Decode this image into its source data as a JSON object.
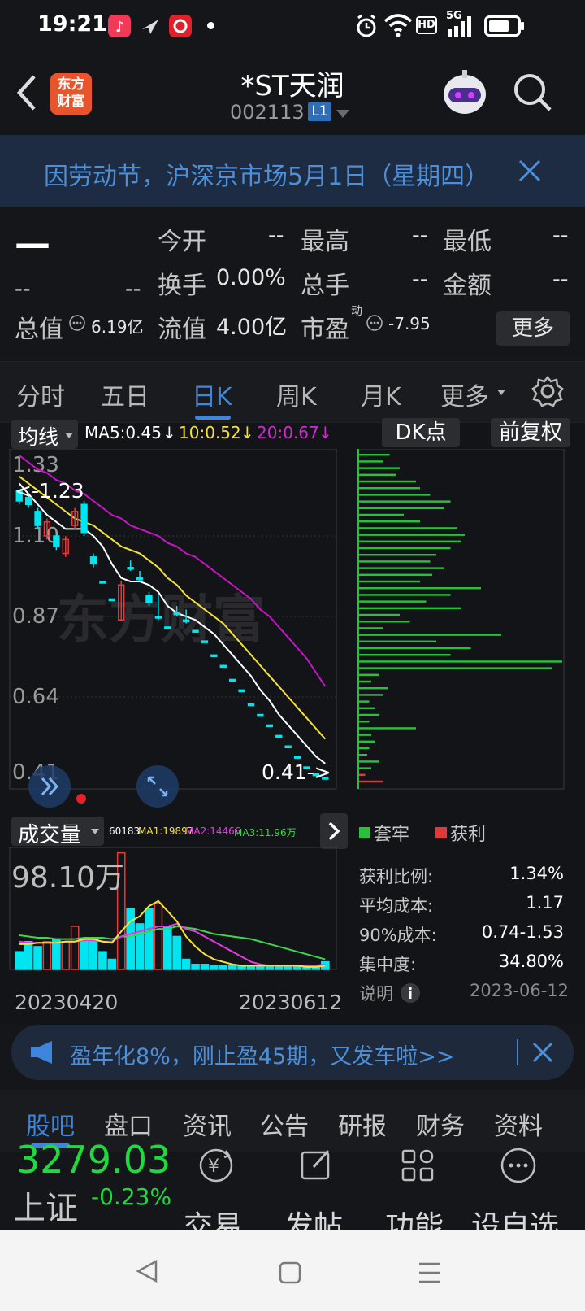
{
  "status_bar": {
    "time": "19:21",
    "battery": "battery-icon",
    "network": "5G",
    "hd": "HD"
  },
  "header": {
    "logo_line1": "东方",
    "logo_line2": "财富",
    "stock_name": "*ST天润",
    "stock_code": "002113",
    "level_badge": "L1"
  },
  "notice": {
    "text": "因劳动节，沪深京市场5月1日（星期四）"
  },
  "quote": {
    "price": "—",
    "change": "--",
    "change_pct": "--",
    "open_label": "今开",
    "open_val": "--",
    "high_label": "最高",
    "high_val": "--",
    "low_label": "最低",
    "low_val": "--",
    "turnover_label": "换手",
    "turnover_val": "0.00%",
    "volume_label": "总手",
    "volume_val": "--",
    "amount_label": "金额",
    "amount_val": "--",
    "mcap_label": "总值",
    "mcap_val": "6.19亿",
    "float_label": "流值",
    "float_val": "4.00亿",
    "pe_label": "市盈",
    "pe_super": "动",
    "pe_val": "-7.95",
    "more_button": "更多"
  },
  "k_tabs": [
    "分时",
    "五日",
    "日K",
    "周K",
    "月K",
    "更多"
  ],
  "k_tab_active": 2,
  "chart_toolbar": {
    "ma_select": "均线",
    "ma5": "MA5:0.45",
    "ma10": "10:0.52",
    "ma20": "20:0.67",
    "dk_button": "DK点",
    "adjust_button": "前复权"
  },
  "kline": {
    "y_labels": [
      "1.33",
      "1.10",
      "0.87",
      "0.64",
      "0.41"
    ],
    "high_marker": "<-1.23",
    "low_marker": "0.41->",
    "watermark": "东方财富",
    "colors": {
      "up": "#e83a3a",
      "down": "#00e5ef",
      "ma5": "#ffffff",
      "ma10": "#f5e13a",
      "ma20": "#c814c8"
    }
  },
  "chart_data": {
    "type": "candlestick",
    "x_start": "20230420",
    "x_end": "20230612",
    "ylim": [
      0.41,
      1.33
    ],
    "candles": [
      {
        "o": 1.23,
        "c": 1.2,
        "h": 1.23,
        "l": 1.19
      },
      {
        "o": 1.21,
        "c": 1.19,
        "h": 1.22,
        "l": 1.18
      },
      {
        "o": 1.17,
        "c": 1.13,
        "h": 1.18,
        "l": 1.12
      },
      {
        "o": 1.1,
        "c": 1.14,
        "h": 1.15,
        "l": 1.09
      },
      {
        "o": 1.1,
        "c": 1.07,
        "h": 1.11,
        "l": 1.06
      },
      {
        "o": 1.05,
        "c": 1.09,
        "h": 1.1,
        "l": 1.04
      },
      {
        "o": 1.13,
        "c": 1.17,
        "h": 1.18,
        "l": 1.12
      },
      {
        "o": 1.19,
        "c": 1.11,
        "h": 1.2,
        "l": 1.1
      },
      {
        "o": 1.04,
        "c": 1.02,
        "h": 1.05,
        "l": 1.01
      },
      {
        "o": 0.97,
        "c": 0.97,
        "h": 0.97,
        "l": 0.97
      },
      {
        "o": 0.92,
        "c": 0.92,
        "h": 0.92,
        "l": 0.92
      },
      {
        "o": 0.86,
        "c": 0.96,
        "h": 0.97,
        "l": 0.86
      },
      {
        "o": 1.01,
        "c": 1.01,
        "h": 1.03,
        "l": 1.0
      },
      {
        "o": 0.98,
        "c": 0.98,
        "h": 1.0,
        "l": 0.97
      },
      {
        "o": 0.93,
        "c": 0.91,
        "h": 0.94,
        "l": 0.9
      },
      {
        "o": 0.87,
        "c": 0.87,
        "h": 0.93,
        "l": 0.86
      },
      {
        "o": 0.84,
        "c": 0.84,
        "h": 0.84,
        "l": 0.84
      },
      {
        "o": 0.88,
        "c": 0.88,
        "h": 0.9,
        "l": 0.87
      },
      {
        "o": 0.86,
        "c": 0.86,
        "h": 0.89,
        "l": 0.85
      },
      {
        "o": 0.83,
        "c": 0.83,
        "h": 0.83,
        "l": 0.83
      },
      {
        "o": 0.8,
        "c": 0.8,
        "h": 0.8,
        "l": 0.8
      },
      {
        "o": 0.76,
        "c": 0.76,
        "h": 0.76,
        "l": 0.76
      },
      {
        "o": 0.73,
        "c": 0.73,
        "h": 0.73,
        "l": 0.73
      },
      {
        "o": 0.69,
        "c": 0.69,
        "h": 0.69,
        "l": 0.69
      },
      {
        "o": 0.66,
        "c": 0.66,
        "h": 0.66,
        "l": 0.66
      },
      {
        "o": 0.62,
        "c": 0.62,
        "h": 0.62,
        "l": 0.62
      },
      {
        "o": 0.59,
        "c": 0.59,
        "h": 0.59,
        "l": 0.59
      },
      {
        "o": 0.56,
        "c": 0.56,
        "h": 0.56,
        "l": 0.56
      },
      {
        "o": 0.53,
        "c": 0.53,
        "h": 0.53,
        "l": 0.53
      },
      {
        "o": 0.5,
        "c": 0.5,
        "h": 0.5,
        "l": 0.5
      },
      {
        "o": 0.47,
        "c": 0.47,
        "h": 0.47,
        "l": 0.47
      },
      {
        "o": 0.44,
        "c": 0.44,
        "h": 0.44,
        "l": 0.44
      },
      {
        "o": 0.42,
        "c": 0.42,
        "h": 0.42,
        "l": 0.42
      },
      {
        "o": 0.41,
        "c": 0.41,
        "h": 0.41,
        "l": 0.41
      }
    ],
    "ma5": [
      1.25,
      1.22,
      1.19,
      1.16,
      1.14,
      1.12,
      1.12,
      1.12,
      1.1,
      1.07,
      1.02,
      0.98,
      0.97,
      0.97,
      0.96,
      0.94,
      0.9,
      0.88,
      0.87,
      0.86,
      0.84,
      0.82,
      0.79,
      0.76,
      0.73,
      0.7,
      0.66,
      0.63,
      0.59,
      0.56,
      0.53,
      0.5,
      0.47,
      0.45
    ],
    "ma10": [
      1.27,
      1.25,
      1.23,
      1.21,
      1.19,
      1.17,
      1.15,
      1.14,
      1.13,
      1.11,
      1.09,
      1.07,
      1.06,
      1.05,
      1.03,
      1.01,
      0.98,
      0.96,
      0.93,
      0.91,
      0.89,
      0.87,
      0.85,
      0.82,
      0.79,
      0.76,
      0.73,
      0.7,
      0.67,
      0.64,
      0.61,
      0.58,
      0.55,
      0.52
    ],
    "ma20": [
      1.33,
      1.31,
      1.29,
      1.28,
      1.26,
      1.25,
      1.23,
      1.22,
      1.2,
      1.18,
      1.16,
      1.15,
      1.13,
      1.12,
      1.11,
      1.1,
      1.08,
      1.07,
      1.05,
      1.04,
      1.02,
      1.0,
      0.98,
      0.96,
      0.94,
      0.92,
      0.89,
      0.87,
      0.84,
      0.81,
      0.78,
      0.75,
      0.71,
      0.67
    ],
    "volume": [
      14,
      22,
      18,
      22,
      24,
      22,
      34,
      24,
      22,
      14,
      8,
      92,
      48,
      36,
      48,
      52,
      34,
      26,
      8,
      4,
      4,
      3,
      3,
      3,
      3,
      3,
      2,
      2,
      2,
      2,
      2,
      2,
      3,
      6
    ],
    "volume_up": [
      false,
      false,
      false,
      true,
      false,
      true,
      true,
      false,
      false,
      false,
      false,
      true,
      false,
      false,
      false,
      true,
      false,
      false,
      false,
      false,
      false,
      false,
      false,
      false,
      false,
      false,
      false,
      false,
      false,
      false,
      false,
      false,
      false,
      false
    ],
    "vol_ma1": [
      20,
      20,
      21,
      21,
      21,
      22,
      22,
      24,
      24,
      22,
      21,
      30,
      38,
      42,
      50,
      54,
      46,
      38,
      26,
      18,
      12,
      8,
      6,
      4,
      3,
      3,
      3,
      3,
      3,
      3,
      3,
      2,
      2,
      3
    ],
    "vol_ma2": [
      22,
      21,
      21,
      21,
      21,
      22,
      22,
      23,
      23,
      22,
      22,
      26,
      28,
      30,
      32,
      34,
      34,
      36,
      32,
      30,
      26,
      22,
      18,
      14,
      10,
      6,
      4,
      3,
      3,
      3,
      3,
      3,
      3,
      4
    ],
    "vol_ma3": [
      27,
      26,
      25,
      25,
      24,
      24,
      24,
      25,
      25,
      25,
      24,
      26,
      26,
      28,
      30,
      32,
      32,
      34,
      33,
      32,
      30,
      28,
      27,
      26,
      25,
      24,
      22,
      20,
      18,
      16,
      14,
      12,
      10,
      8
    ]
  },
  "volume_panel": {
    "select": "成交量",
    "v1": "60183",
    "ma1": "MA1:19897",
    "ma2": "MA2:14466",
    "ma3": "MA3:11.96万",
    "max_label": "98.10万",
    "date_start": "20230420",
    "date_end": "20230612"
  },
  "chip_dist": {
    "bars": [
      0.15,
      0.12,
      0.2,
      0.18,
      0.28,
      0.3,
      0.35,
      0.45,
      0.42,
      0.22,
      0.3,
      0.48,
      0.52,
      0.5,
      0.45,
      0.38,
      0.35,
      0.42,
      0.36,
      0.3,
      0.6,
      0.45,
      0.33,
      0.5,
      0.2,
      0.25,
      0.12,
      0.7,
      0.38,
      0.55,
      0.45,
      1.0,
      0.95,
      0.1,
      0.06,
      0.14,
      0.12,
      0.05,
      0.08,
      0.1,
      0.05,
      0.28,
      0.06,
      0.08,
      0.05,
      0.04,
      0.1,
      0.06,
      0.03,
      0.12
    ],
    "profit_index": [
      23,
      49
    ],
    "legend_trapped": "套牢",
    "legend_profit": "获利",
    "profit_ratio_label": "获利比例:",
    "profit_ratio": "1.34%",
    "avg_cost_label": "平均成本:",
    "avg_cost": "1.17",
    "cost90_label": "90%成本:",
    "cost90": "0.74-1.53",
    "concentration_label": "集中度:",
    "concentration": "34.80%",
    "explain_label": "说明",
    "date": "2023-06-12"
  },
  "ad": {
    "text": "盈年化8%，刚止盈45期，又发车啦>>"
  },
  "bottom_tabs": [
    "股吧",
    "盘口",
    "资讯",
    "公告",
    "研报",
    "财务",
    "资料"
  ],
  "bottom_tab_active": 0,
  "footer": {
    "index_price": "3279.03",
    "index_name": "上证",
    "index_change": "-0.23%",
    "trade": "交易",
    "post": "发帖",
    "func": "功能",
    "watch": "设自选"
  }
}
